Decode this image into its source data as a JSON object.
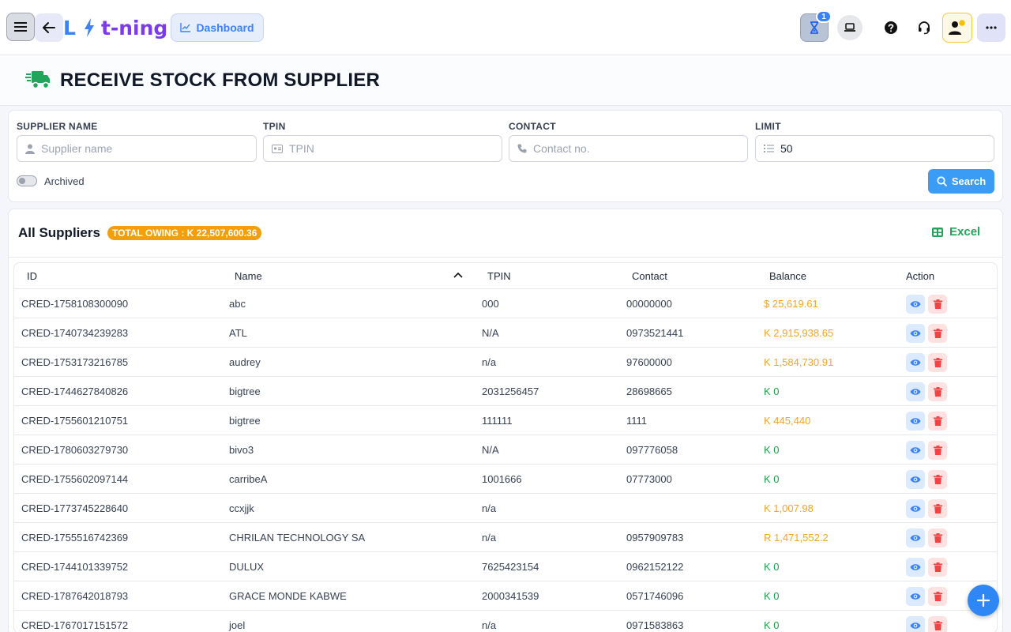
{
  "header": {
    "logo_left": "L",
    "logo_right": "t-ning",
    "dashboard_label": "Dashboard",
    "pending_count": "1"
  },
  "page": {
    "title": "RECEIVE STOCK FROM SUPPLIER"
  },
  "filters": {
    "supplier_label": "SUPPLIER NAME",
    "supplier_placeholder": "Supplier name",
    "tpin_label": "TPIN",
    "tpin_placeholder": "TPIN",
    "contact_label": "CONTACT",
    "contact_placeholder": "Contact no.",
    "limit_label": "LIMIT",
    "limit_value": "50",
    "archived_label": "Archived",
    "search_label": "Search"
  },
  "suppliers": {
    "title": "All Suppliers",
    "total_owing": "TOTAL OWING : K 22,507,600.36",
    "excel_label": "Excel",
    "columns": [
      "ID",
      "Name",
      "TPIN",
      "Contact",
      "Balance",
      "Action"
    ],
    "rows": [
      {
        "id": "CRED-1758108300090",
        "name": "abc",
        "tpin": "000",
        "contact": "00000000",
        "balance": "$ 25,619.61",
        "owing": true
      },
      {
        "id": "CRED-1740734239283",
        "name": "ATL",
        "tpin": "N/A",
        "contact": "0973521441",
        "balance": "K 2,915,938.65",
        "owing": true
      },
      {
        "id": "CRED-1753173216785",
        "name": "audrey",
        "tpin": "n/a",
        "contact": "97600000",
        "balance": "K 1,584,730.91",
        "owing": true
      },
      {
        "id": "CRED-1744627840826",
        "name": "bigtree",
        "tpin": "2031256457",
        "contact": "28698665",
        "balance": "K 0",
        "owing": false
      },
      {
        "id": "CRED-1755601210751",
        "name": "bigtree",
        "tpin": "111111",
        "contact": "1111",
        "balance": "K 445,440",
        "owing": true
      },
      {
        "id": "CRED-1780603279730",
        "name": "bivo3",
        "tpin": "N/A",
        "contact": "097776058",
        "balance": "K 0",
        "owing": false
      },
      {
        "id": "CRED-1755602097144",
        "name": "carribeA",
        "tpin": "1001666",
        "contact": "07773000",
        "balance": "K 0",
        "owing": false
      },
      {
        "id": "CRED-1773745228640",
        "name": "ccxjjk",
        "tpin": "n/a",
        "contact": "",
        "balance": "K 1,007.98",
        "owing": true
      },
      {
        "id": "CRED-1755516742369",
        "name": "CHRILAN TECHNOLOGY SA",
        "tpin": "n/a",
        "contact": "0957909783",
        "balance": "R 1,471,552.2",
        "owing": true
      },
      {
        "id": "CRED-1744101339752",
        "name": "DULUX",
        "tpin": "7625423154",
        "contact": "0962152122",
        "balance": "K 0",
        "owing": false
      },
      {
        "id": "CRED-1787642018793",
        "name": "GRACE MONDE KABWE",
        "tpin": "2000341539",
        "contact": "0571746096",
        "balance": "K 0",
        "owing": false
      },
      {
        "id": "CRED-1767017151572",
        "name": "joel",
        "tpin": "n/a",
        "contact": "0971583863",
        "balance": "K 0",
        "owing": false
      }
    ]
  },
  "colors": {
    "accent": "#3b82f6",
    "owing": "#f5a524",
    "settled": "#16a34a",
    "excel": "#22a55b",
    "delete": "#ef4444"
  }
}
